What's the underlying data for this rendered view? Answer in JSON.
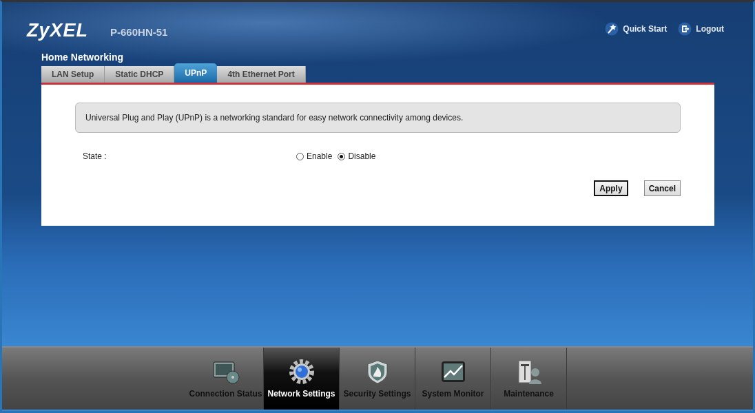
{
  "header": {
    "logo": "ZyXEL",
    "model": "P-660HN-51",
    "links": [
      {
        "label": "Quick Start",
        "kind": "wand"
      },
      {
        "label": "Logout",
        "kind": "logout"
      }
    ]
  },
  "section_title": "Home Networking",
  "tabs": [
    {
      "label": "LAN Setup",
      "selected": false
    },
    {
      "label": "Static DHCP",
      "selected": false
    },
    {
      "label": "UPnP",
      "selected": true
    },
    {
      "label": "4th Ethernet Port",
      "selected": false
    }
  ],
  "description": "Universal Plug and Play (UPnP) is a networking standard for easy network connectivity among devices.",
  "state": {
    "label": "State :",
    "options": [
      {
        "label": "Enable",
        "selected": false
      },
      {
        "label": "Disable",
        "selected": true
      }
    ]
  },
  "buttons": [
    {
      "label": "Apply",
      "default": true
    },
    {
      "label": "Cancel",
      "default": false
    }
  ],
  "nav": [
    {
      "label": "Connection Status",
      "kind": "status",
      "selected": false
    },
    {
      "label": "Network Settings",
      "kind": "gear",
      "selected": true
    },
    {
      "label": "Security Settings",
      "kind": "shield",
      "selected": false
    },
    {
      "label": "System Monitor",
      "kind": "monitor",
      "selected": false
    },
    {
      "label": "Maintenance",
      "kind": "maintenance",
      "selected": false
    }
  ]
}
